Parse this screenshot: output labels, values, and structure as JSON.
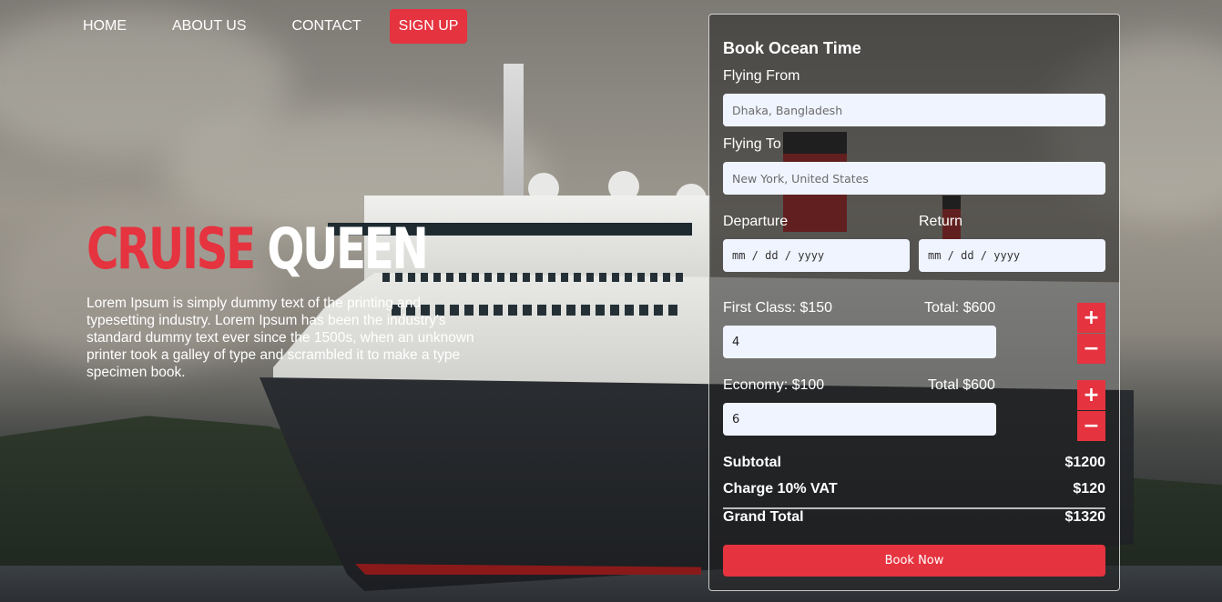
{
  "nav": {
    "home": "HOME",
    "about": "ABOUT US",
    "contact": "CONTACT",
    "signup": "SIGN UP"
  },
  "hero": {
    "title_red": "CRUISE",
    "title_white": "QUEEN",
    "description": "Lorem Ipsum is simply dummy text of the printing and typesetting industry. Lorem Ipsum has been the industry's standard dummy text ever since the 1500s, when an unknown printer took a galley of type and scrambled it to make a type specimen book."
  },
  "booking": {
    "title": "Book Ocean Time",
    "from_label": "Flying From",
    "from_value": "Dhaka, Bangladesh",
    "to_label": "Flying To",
    "to_value": "New York, United States",
    "departure_label": "Departure",
    "departure_placeholder": "mm / dd / yyyy",
    "return_label": "Return",
    "return_placeholder": "mm / dd / yyyy",
    "first_class_label": "First Class: $150",
    "first_class_total": "Total: $600",
    "first_class_qty": "4",
    "economy_label": "Economy: $100",
    "economy_total": "Total $600",
    "economy_qty": "6",
    "plus": "+",
    "minus": "−",
    "subtotal_label": "Subtotal",
    "subtotal_value": "$1200",
    "vat_label": "Charge 10% VAT",
    "vat_value": "$120",
    "grand_label": "Grand Total",
    "grand_value": "$1320",
    "book_button": "Book Now"
  },
  "colors": {
    "accent": "#e5333f",
    "field_bg": "#f0f4ff"
  }
}
